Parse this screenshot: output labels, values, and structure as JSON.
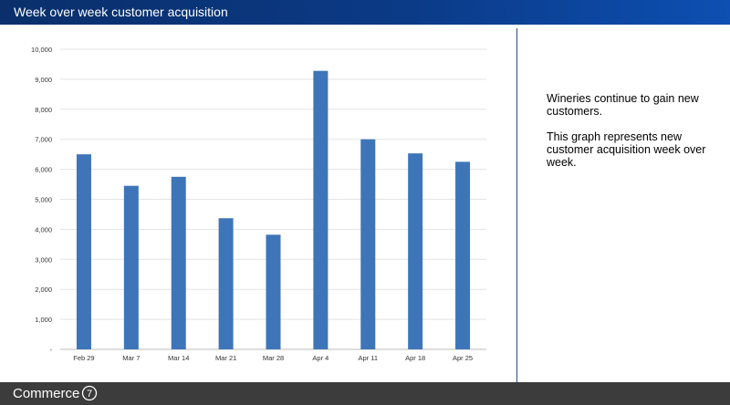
{
  "header": {
    "title": "Week over week customer acquisition"
  },
  "colors": {
    "header_accent": "#0b3a86",
    "bar": "#3e75b9",
    "footer": "#3c3c3c"
  },
  "chart_data": {
    "type": "bar",
    "title": "",
    "xlabel": "",
    "ylabel": "",
    "categories": [
      "Feb 29",
      "Mar 7",
      "Mar 14",
      "Mar 21",
      "Mar 28",
      "Apr 4",
      "Apr 11",
      "Apr 18",
      "Apr 25"
    ],
    "values": [
      6500,
      5450,
      5750,
      4370,
      3820,
      9280,
      7000,
      6530,
      6250
    ],
    "ylim": [
      0,
      10000
    ],
    "yticks": [
      0,
      1000,
      2000,
      3000,
      4000,
      5000,
      6000,
      7000,
      8000,
      9000,
      10000
    ],
    "ytick_labels": [
      "-",
      "1,000",
      "2,000",
      "3,000",
      "4,000",
      "5,000",
      "6,000",
      "7,000",
      "8,000",
      "9,000",
      "10,000"
    ],
    "grid": true,
    "legend": "none"
  },
  "caption": {
    "line1": "Wineries continue to gain new customers.",
    "line2": "This graph represents new customer acquisition week over week."
  },
  "footer": {
    "brand": "Commerce",
    "brand_mark": "7",
    "brand_mark_icon": "circled-seven-icon"
  }
}
